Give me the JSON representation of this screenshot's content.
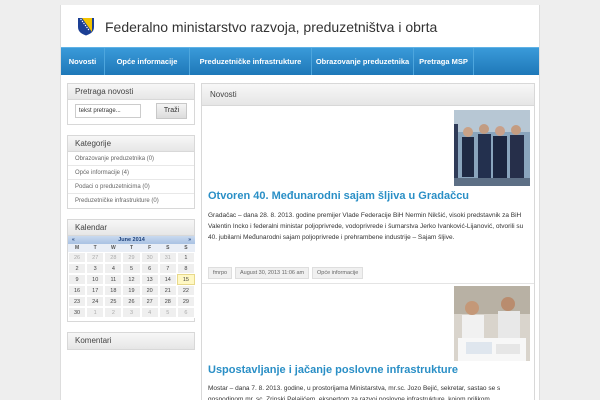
{
  "site": {
    "title": "Federalno ministarstvo razvoja, preduzetništva i obrta"
  },
  "nav": [
    {
      "label": "Novosti"
    },
    {
      "label": "Opće informacije"
    },
    {
      "label": "Preduzetničke infrastrukture"
    },
    {
      "label": "Obrazovanje preduzetnika"
    },
    {
      "label": "Pretraga MSP"
    }
  ],
  "colors": {
    "nav": "#1e78b8",
    "link": "#2a8fc6",
    "today": "#fff8c4"
  },
  "search": {
    "title": "Pretraga novosti",
    "value": "tekst pretrage...",
    "button": "Traži"
  },
  "categories": {
    "title": "Kategorije",
    "items": [
      "Obrazovanje preduzetnika (0)",
      "Opće informacije (4)",
      "Podaci o preduzetnicima (0)",
      "Preduzetničke infrastrukture (0)"
    ]
  },
  "calendar": {
    "title": "Kalendar",
    "month": "June 2014",
    "prev": "«",
    "next": "»",
    "days_of_week": [
      "M",
      "T",
      "W",
      "T",
      "F",
      "S",
      "S"
    ],
    "weeks": [
      [
        "26",
        "27",
        "28",
        "29",
        "30",
        "31",
        "1"
      ],
      [
        "2",
        "3",
        "4",
        "5",
        "6",
        "7",
        "8"
      ],
      [
        "9",
        "10",
        "11",
        "12",
        "13",
        "14",
        "15"
      ],
      [
        "16",
        "17",
        "18",
        "19",
        "20",
        "21",
        "22"
      ],
      [
        "23",
        "24",
        "25",
        "26",
        "27",
        "28",
        "29"
      ],
      [
        "30",
        "1",
        "2",
        "3",
        "4",
        "5",
        "6"
      ]
    ],
    "today": "15"
  },
  "comments": {
    "title": "Komentari"
  },
  "content": {
    "title": "Novosti",
    "posts": [
      {
        "title": "Otvoren 40. Međunarodni sajam šljiva u Gradačcu",
        "text": "Gradačac – dana 28. 8. 2013. godine premijer Vlade Federacije BiH Nermin Nikšić, visoki predstavnik za BiH Valentin Incko i federalni ministar poljoprivrede, vodoprivrede i šumarstva Jerko Ivanković-Lijanović, otvorili su 40. jubilarni Međunarodni sajam poljoprivrede i prehrambene industrije – Sajam šljive.",
        "meta": [
          "fmrpo",
          "August 30, 2013 11:06 am",
          "Opće informacije"
        ]
      },
      {
        "title": "Uspostavljanje i jačanje poslovne infrastrukture",
        "text": "Mostar – dana 7. 8. 2013. godine, u prostorijama Ministarstva, mr.sc. Jozo Bejić, sekretar, sastao se s gospodinom mr. sc. Zrinski Pelajićem, ekspertom za razvoj poslovne infrastrukture, kojom prilikom"
      }
    ]
  }
}
